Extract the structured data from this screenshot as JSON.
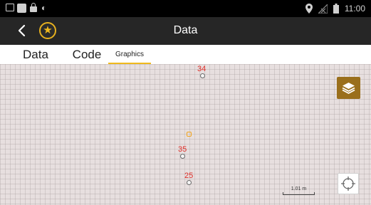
{
  "status_bar": {
    "time": "11:00",
    "icons_left": [
      "image-icon",
      "square-icon",
      "lock-icon",
      "android-icon"
    ],
    "icons_right": [
      "location-pin-icon",
      "no-signal-icon",
      "battery-icon"
    ]
  },
  "app_bar": {
    "title": "Data",
    "back_icon": "chevron-left-icon",
    "favorite_icon": "star-icon",
    "accent_color": "#f0b91c",
    "background_color": "#262626"
  },
  "tabs": [
    {
      "label": "Data",
      "active": false
    },
    {
      "label": "Code",
      "active": false
    },
    {
      "label": "Graphics",
      "active": true
    }
  ],
  "map": {
    "points": [
      {
        "label": "34"
      },
      {
        "label": "35"
      },
      {
        "label": "25"
      }
    ],
    "highlighted_marker": "orange",
    "scale_label": "1.01 m",
    "layers_button_icon": "layers-icon",
    "locate_button_icon": "crosshair-icon"
  }
}
